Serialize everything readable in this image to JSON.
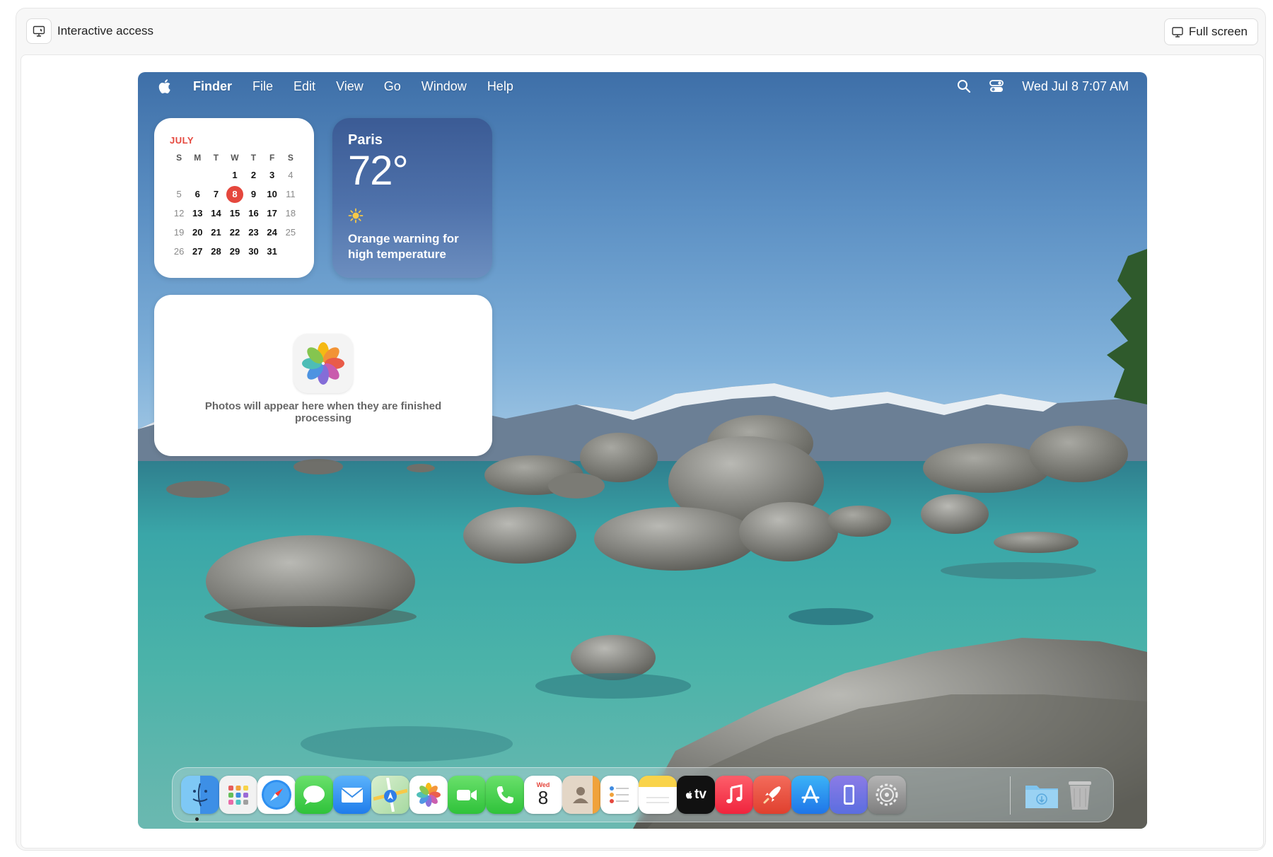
{
  "topbar": {
    "interactive_label": "Interactive access",
    "fullscreen_label": "Full screen"
  },
  "menubar": {
    "app_name": "Finder",
    "menus": [
      "File",
      "Edit",
      "View",
      "Go",
      "Window",
      "Help"
    ],
    "clock": "Wed Jul 8  7:07 AM"
  },
  "calendar": {
    "month": "JULY",
    "weekdays": [
      "S",
      "M",
      "T",
      "W",
      "T",
      "F",
      "S"
    ],
    "weeks": [
      [
        "",
        "",
        "",
        "1",
        "2",
        "3",
        "4"
      ],
      [
        "5",
        "6",
        "7",
        "8",
        "9",
        "10",
        "11"
      ],
      [
        "12",
        "13",
        "14",
        "15",
        "16",
        "17",
        "18"
      ],
      [
        "19",
        "20",
        "21",
        "22",
        "23",
        "24",
        "25"
      ],
      [
        "26",
        "27",
        "28",
        "29",
        "30",
        "31",
        ""
      ]
    ],
    "today": "8"
  },
  "weather": {
    "city": "Paris",
    "temperature": "72°",
    "condition_icon": "sun-icon",
    "alert": "Orange warning for high temperature"
  },
  "photos_widget": {
    "message": "Photos will appear here when they are finished processing"
  },
  "dock": {
    "apps": [
      "finder",
      "launchpad",
      "safari",
      "messages",
      "mail",
      "maps",
      "photos",
      "facetime",
      "phone",
      "calendar",
      "contacts",
      "reminders",
      "notes",
      "tv",
      "music",
      "rocket",
      "app-store",
      "iphone-mirroring",
      "system-settings",
      "downloads",
      "trash"
    ],
    "calendar_icon_day": "Wed",
    "calendar_icon_date": "8",
    "tv_label": "tv"
  },
  "colors": {
    "accent_red": "#e5473d",
    "weather_blue": "#4f72ab"
  }
}
